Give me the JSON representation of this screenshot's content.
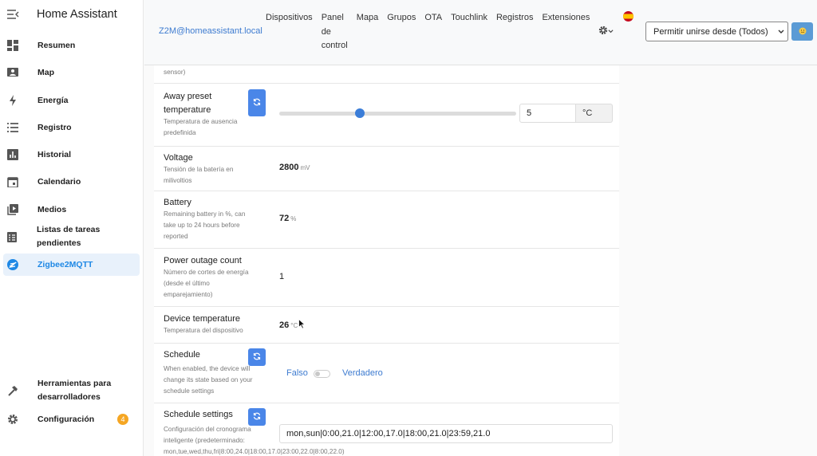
{
  "sidebar": {
    "title": "Home Assistant",
    "items": [
      {
        "label": "Resumen",
        "icon": "dashboard-icon"
      },
      {
        "label": "Map",
        "icon": "map-icon"
      },
      {
        "label": "Energía",
        "icon": "lightning-icon"
      },
      {
        "label": "Registro",
        "icon": "list-icon"
      },
      {
        "label": "Historial",
        "icon": "chart-icon"
      },
      {
        "label": "Calendario",
        "icon": "calendar-icon"
      },
      {
        "label": "Medios",
        "icon": "media-icon"
      },
      {
        "label": "Listas de tareas pendientes",
        "icon": "clipboard-icon"
      },
      {
        "label": "Zigbee2MQTT",
        "icon": "zigbee-icon"
      }
    ],
    "dev_tools": {
      "label_1": "Herramientas para",
      "label_2": "desarrolladores"
    },
    "settings": {
      "label": "Configuración",
      "badge": "4"
    }
  },
  "topbar": {
    "host": "Z2M@homeassistant.local",
    "nav": {
      "devices": "Dispositivos",
      "panel_1": "Panel",
      "panel_2": "de",
      "panel_3": "control",
      "map": "Mapa",
      "groups": "Grupos",
      "ota": "OTA",
      "touchlink": "Touchlink",
      "logs": "Registros",
      "extensions": "Extensiones"
    },
    "permit_join": "Permitir unirse desde (Todos)"
  },
  "features": {
    "prev_tail": "sensor)",
    "away_preset": {
      "name_1": "Away preset",
      "name_2": "temperature",
      "desc_1": "Temperatura de ausencia",
      "desc_2": "predefinida",
      "value": "5",
      "unit": "°C",
      "slider_fraction": 0.34
    },
    "voltage": {
      "name": "Voltage",
      "desc_1": "Tensión de la batería en",
      "desc_2": "milivoltios",
      "value": "2800",
      "unit": "mV"
    },
    "battery": {
      "name": "Battery",
      "desc_1": "Remaining battery in %, can",
      "desc_2": "take up to 24 hours before",
      "desc_3": "reported",
      "value": "72",
      "unit": "%"
    },
    "power_outage": {
      "name": "Power outage count",
      "desc_1": "Número de cortes de energía",
      "desc_2": "(desde el último",
      "desc_3": "emparejamiento)",
      "value": "1"
    },
    "device_temp": {
      "name": "Device temperature",
      "desc_1": "Temperatura del dispositivo",
      "value": "26",
      "unit": "°C"
    },
    "schedule": {
      "name": "Schedule",
      "desc_1": "When enabled, the device will",
      "desc_2": "change its state based on your",
      "desc_3": "schedule settings",
      "false_label": "Falso",
      "true_label": "Verdadero"
    },
    "schedule_settings": {
      "name": "Schedule settings",
      "desc_1": "Configuración del cronograma",
      "desc_2": "inteligente (predeterminado:",
      "desc_3": "mon,tue,wed,thu,fri|8:00,24.0|18:00,17.0|23:00,22.0|8:00,22.0)",
      "value": "mon,sun|0:00,21.0|12:00,17.0|18:00,21.0|23:59,21.0"
    }
  },
  "colors": {
    "accent": "#1e88e5",
    "button": "#4a86e8",
    "badge": "#f5a623"
  }
}
